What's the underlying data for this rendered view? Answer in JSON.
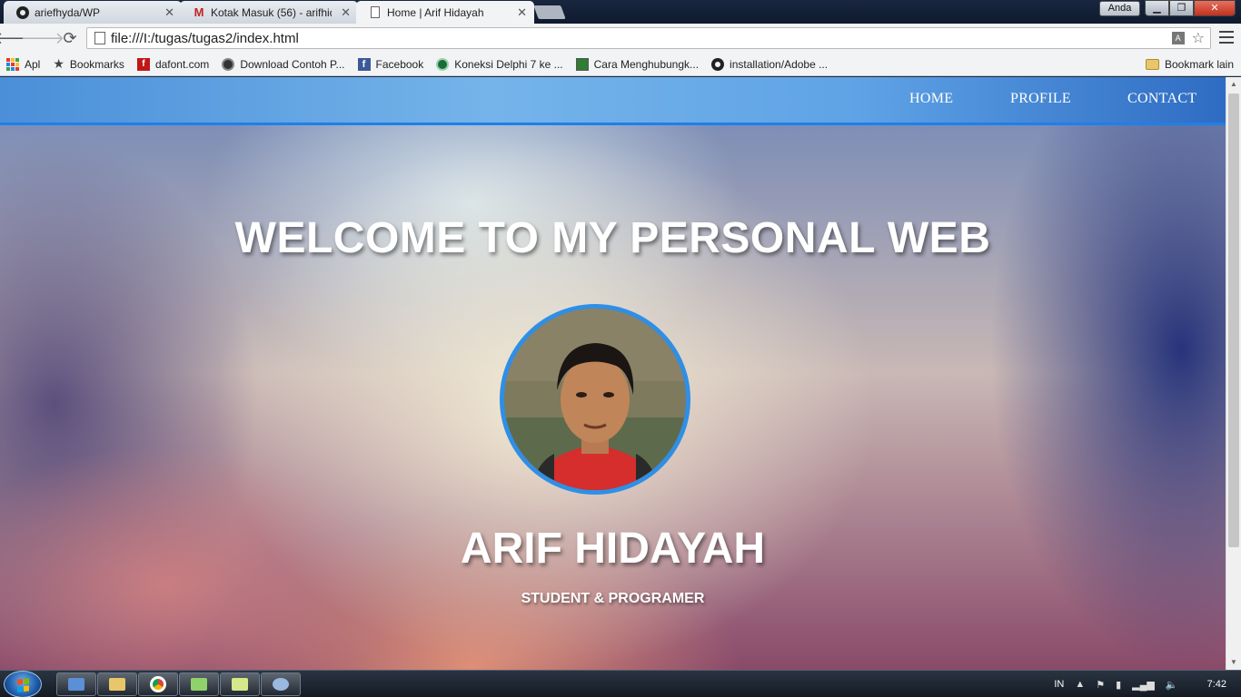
{
  "browser": {
    "tabs": [
      {
        "title": "ariefhyda/WP",
        "icon": "github-icon"
      },
      {
        "title": "Kotak Masuk (56) - arifhid",
        "icon": "gmail-icon"
      },
      {
        "title": "Home | Arif Hidayah",
        "icon": "page-icon"
      }
    ],
    "user_button": "Anda",
    "url": "file:///I:/tugas/tugas2/index.html",
    "bookmarks": [
      {
        "label": "Apl",
        "icon": "apps-icon"
      },
      {
        "label": "Bookmarks",
        "icon": "star-icon"
      },
      {
        "label": "dafont.com",
        "icon": "dafont-icon"
      },
      {
        "label": "Download Contoh P...",
        "icon": "globe-icon"
      },
      {
        "label": "Facebook",
        "icon": "facebook-icon"
      },
      {
        "label": "Koneksi Delphi 7 ke ...",
        "icon": "koneksi-icon"
      },
      {
        "label": "Cara Menghubungk...",
        "icon": "cara-icon"
      },
      {
        "label": "installation/Adobe ...",
        "icon": "github-icon"
      }
    ],
    "other_bookmarks": "Bookmark lain"
  },
  "site": {
    "nav": [
      "HOME",
      "PROFILE",
      "CONTACT"
    ],
    "welcome": "WELCOME TO MY PERSONAL WEB",
    "name": "ARIF HIDAYAH",
    "subtitle": "STUDENT & PROGRAMER",
    "accent_color": "#2f8fe6"
  },
  "taskbar": {
    "language": "IN",
    "clock": "7:42"
  }
}
